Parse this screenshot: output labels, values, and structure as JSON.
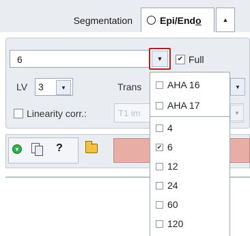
{
  "segmentation": {
    "label": "Segmentation",
    "mode_button": "Epi/Endo"
  },
  "sector_select": {
    "value": "6",
    "full_label": "Full",
    "full_checked": true
  },
  "lv": {
    "label": "LV",
    "value": "3"
  },
  "transform_label": "Trans",
  "linearity": {
    "label": "Linearity corr.:",
    "checked": false,
    "combo_value": "T1 im"
  },
  "dropdown": {
    "items": [
      {
        "label": "AHA 16",
        "checked": false
      },
      {
        "label": "AHA 17",
        "checked": false
      },
      {
        "label": "4",
        "checked": false
      },
      {
        "label": "6",
        "checked": true
      },
      {
        "label": "12",
        "checked": false
      },
      {
        "label": "24",
        "checked": false
      },
      {
        "label": "60",
        "checked": false
      },
      {
        "label": "120",
        "checked": false
      }
    ]
  },
  "toolbar": {
    "help_label": "?"
  },
  "colors": {
    "panel_bg": "#e9ecf1",
    "highlight_border": "#b02020",
    "result_box": "#e8ada5"
  },
  "icons": [
    "circle-icon",
    "chevron-up-icon",
    "chevron-down-icon",
    "checkmark-icon",
    "green-play-icon",
    "copy-icon",
    "help-icon",
    "folder-open-icon"
  ]
}
